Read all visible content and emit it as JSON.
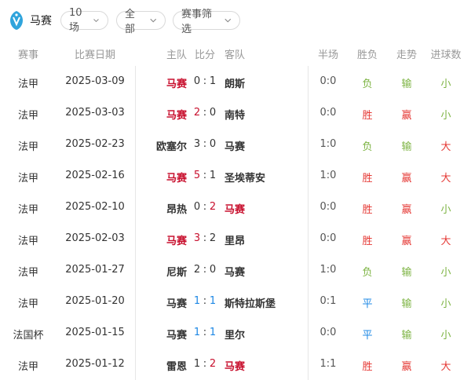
{
  "team": {
    "name": "马赛"
  },
  "filters": {
    "count_label": "10场",
    "scope_label": "全部",
    "event_filter_label": "赛事筛选"
  },
  "headers": {
    "league": "赛事",
    "date": "比赛日期",
    "home": "主队",
    "score": "比分",
    "away": "客队",
    "half": "半场",
    "result": "胜负",
    "trend": "走势",
    "goals": "进球数"
  },
  "colors": {
    "highlight_team": "#c8102e",
    "win": "#e53935",
    "lose": "#7cb342",
    "draw": "#1e88e5"
  },
  "matches": [
    {
      "league": "法甲",
      "date": "2025-03-09",
      "home": "马赛",
      "home_goals": "0",
      "away_goals": "1",
      "away": "朗斯",
      "half": "0:0",
      "result": "负",
      "trend": "输",
      "goals": "小"
    },
    {
      "league": "法甲",
      "date": "2025-03-03",
      "home": "马赛",
      "home_goals": "2",
      "away_goals": "0",
      "away": "南特",
      "half": "0:0",
      "result": "胜",
      "trend": "赢",
      "goals": "小"
    },
    {
      "league": "法甲",
      "date": "2025-02-23",
      "home": "欧塞尔",
      "home_goals": "3",
      "away_goals": "0",
      "away": "马赛",
      "half": "1:0",
      "result": "负",
      "trend": "输",
      "goals": "大"
    },
    {
      "league": "法甲",
      "date": "2025-02-16",
      "home": "马赛",
      "home_goals": "5",
      "away_goals": "1",
      "away": "圣埃蒂安",
      "half": "1:0",
      "result": "胜",
      "trend": "赢",
      "goals": "大"
    },
    {
      "league": "法甲",
      "date": "2025-02-10",
      "home": "昂热",
      "home_goals": "0",
      "away_goals": "2",
      "away": "马赛",
      "half": "0:0",
      "result": "胜",
      "trend": "赢",
      "goals": "小"
    },
    {
      "league": "法甲",
      "date": "2025-02-03",
      "home": "马赛",
      "home_goals": "3",
      "away_goals": "2",
      "away": "里昂",
      "half": "0:0",
      "result": "胜",
      "trend": "赢",
      "goals": "大"
    },
    {
      "league": "法甲",
      "date": "2025-01-27",
      "home": "尼斯",
      "home_goals": "2",
      "away_goals": "0",
      "away": "马赛",
      "half": "1:0",
      "result": "负",
      "trend": "输",
      "goals": "小"
    },
    {
      "league": "法甲",
      "date": "2025-01-20",
      "home": "马赛",
      "home_goals": "1",
      "away_goals": "1",
      "away": "斯特拉斯堡",
      "half": "0:1",
      "result": "平",
      "trend": "输",
      "goals": "小"
    },
    {
      "league": "法国杯",
      "date": "2025-01-15",
      "home": "马赛",
      "home_goals": "1",
      "away_goals": "1",
      "away": "里尔",
      "half": "0:0",
      "result": "平",
      "trend": "输",
      "goals": "小"
    },
    {
      "league": "法甲",
      "date": "2025-01-12",
      "home": "雷恩",
      "home_goals": "1",
      "away_goals": "2",
      "away": "马赛",
      "half": "1:1",
      "result": "胜",
      "trend": "赢",
      "goals": "大"
    }
  ]
}
